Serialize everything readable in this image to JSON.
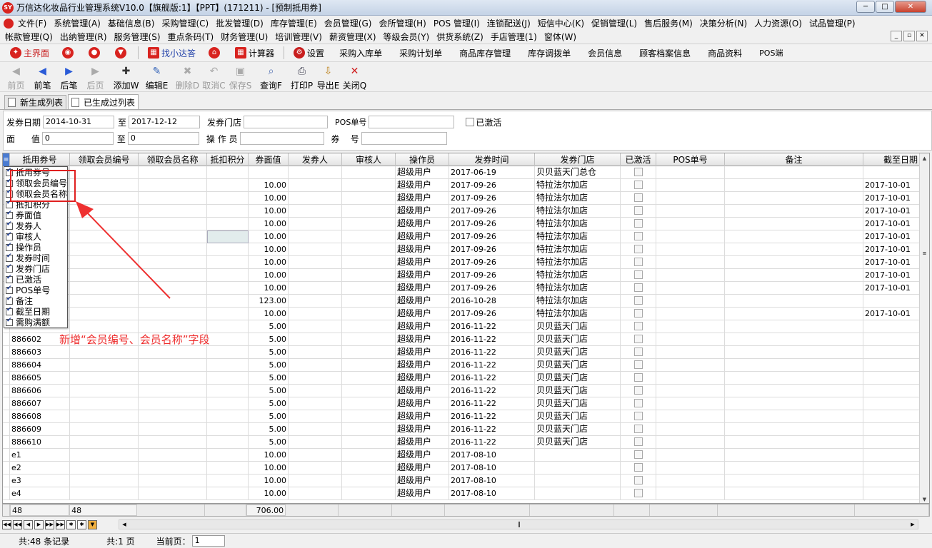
{
  "window": {
    "title": "万信达化妆品行业管理系统V10.0【旗舰版:1】【PPT】(171211) - [预制抵用券]",
    "logo": "SY",
    "min": "─",
    "max": "□",
    "close": "✕"
  },
  "menu": {
    "row1": [
      "文件(F)",
      "系统管理(A)",
      "基础信息(B)",
      "采购管理(C)",
      "批发管理(D)",
      "库存管理(E)",
      "会员管理(G)",
      "会所管理(H)",
      "POS 管理(I)",
      "连锁配送(J)",
      "短信中心(K)",
      "促销管理(L)",
      "售后服务(M)",
      "决策分析(N)",
      "人力资源(O)",
      "试品管理(P)"
    ],
    "row2": [
      "帐款管理(Q)",
      "出纳管理(R)",
      "服务管理(S)",
      "重点条码(T)",
      "财务管理(U)",
      "培训管理(V)",
      "薪资管理(X)",
      "等级会员(Y)",
      "供货系统(Z)",
      "手店管理(1)",
      "窗体(W)"
    ],
    "mdi": [
      "_",
      "▫",
      "✕"
    ]
  },
  "quickbar": {
    "main": "主界面",
    "find": "找小达答",
    "calc": "计算器",
    "settings": "设置",
    "links": [
      "采购入库单",
      "采购计划单",
      "商品库存管理",
      "库存调拨单",
      "会员信息",
      "顾客档案信息",
      "商品资料",
      "POS端"
    ]
  },
  "toolbar": [
    {
      "label": "前页",
      "icon": "◀",
      "disabled": true
    },
    {
      "label": "前笔",
      "icon": "◀",
      "disabled": false
    },
    {
      "label": "后笔",
      "icon": "▶",
      "disabled": false
    },
    {
      "label": "后页",
      "icon": "▶",
      "disabled": true
    },
    {
      "label": "添加W",
      "icon": "✚",
      "disabled": false
    },
    {
      "label": "编辑E",
      "icon": "✎",
      "disabled": false
    },
    {
      "label": "删除D",
      "icon": "✖",
      "disabled": true
    },
    {
      "label": "取消C",
      "icon": "↶",
      "disabled": true
    },
    {
      "label": "保存S",
      "icon": "▣",
      "disabled": true
    },
    {
      "label": "查询F",
      "icon": "⌕",
      "disabled": false
    },
    {
      "label": "打印P",
      "icon": "⎙",
      "disabled": false
    },
    {
      "label": "导出E",
      "icon": "⇩",
      "disabled": false
    },
    {
      "label": "关闭Q",
      "icon": "✕",
      "disabled": false
    }
  ],
  "tabs": [
    "新生成列表",
    "已生成过列表"
  ],
  "filter": {
    "date_label": "发券日期",
    "date_from": "2014-10-31",
    "to_label": "至",
    "date_to": "2017-12-12",
    "store_label": "发券门店",
    "store": "",
    "pos_label": "POS单号",
    "pos": "",
    "activated_label": "已激活",
    "value_label": "面      值",
    "value_from": "0",
    "value_to_label": "至",
    "value_to": "0",
    "operator_label": "操 作 员",
    "operator": "",
    "no_label": "券    号",
    "no": ""
  },
  "grid": {
    "columns": [
      "抵用券号",
      "领取会员编号",
      "领取会员名称",
      "抵扣积分",
      "券面值",
      "发券人",
      "审核人",
      "操作员",
      "发券时间",
      "发券门店",
      "已激活",
      "POS单号",
      "备注",
      "截至日期"
    ],
    "rows": [
      [
        "",
        "",
        "",
        "",
        "",
        "",
        "",
        "超级用户",
        "2017-06-19",
        "贝贝蓝天门总仓",
        "",
        "",
        "",
        ""
      ],
      [
        "",
        "",
        "",
        "",
        "10.00",
        "",
        "",
        "超级用户",
        "2017-09-26",
        "特拉法尔加店",
        "",
        "",
        "",
        "2017-10-01"
      ],
      [
        "",
        "",
        "",
        "",
        "10.00",
        "",
        "",
        "超级用户",
        "2017-09-26",
        "特拉法尔加店",
        "",
        "",
        "",
        "2017-10-01"
      ],
      [
        "",
        "",
        "",
        "",
        "10.00",
        "",
        "",
        "超级用户",
        "2017-09-26",
        "特拉法尔加店",
        "",
        "",
        "",
        "2017-10-01"
      ],
      [
        "",
        "",
        "",
        "",
        "10.00",
        "",
        "",
        "超级用户",
        "2017-09-26",
        "特拉法尔加店",
        "",
        "",
        "",
        "2017-10-01"
      ],
      [
        "",
        "",
        "",
        "",
        "10.00",
        "",
        "",
        "超级用户",
        "2017-09-26",
        "特拉法尔加店",
        "",
        "",
        "",
        "2017-10-01"
      ],
      [
        "",
        "",
        "",
        "",
        "10.00",
        "",
        "",
        "超级用户",
        "2017-09-26",
        "特拉法尔加店",
        "",
        "",
        "",
        "2017-10-01"
      ],
      [
        "",
        "",
        "",
        "",
        "10.00",
        "",
        "",
        "超级用户",
        "2017-09-26",
        "特拉法尔加店",
        "",
        "",
        "",
        "2017-10-01"
      ],
      [
        "",
        "",
        "",
        "",
        "10.00",
        "",
        "",
        "超级用户",
        "2017-09-26",
        "特拉法尔加店",
        "",
        "",
        "",
        "2017-10-01"
      ],
      [
        "",
        "",
        "",
        "",
        "10.00",
        "",
        "",
        "超级用户",
        "2017-09-26",
        "特拉法尔加店",
        "",
        "",
        "",
        "2017-10-01"
      ],
      [
        "",
        "",
        "",
        "",
        "123.00",
        "",
        "",
        "超级用户",
        "2016-10-28",
        "特拉法尔加店",
        "",
        "",
        "",
        ""
      ],
      [
        "",
        "",
        "",
        "",
        "10.00",
        "",
        "",
        "超级用户",
        "2017-09-26",
        "特拉法尔加店",
        "",
        "",
        "",
        "2017-10-01"
      ],
      [
        "",
        "",
        "",
        "",
        "5.00",
        "",
        "",
        "超级用户",
        "2016-11-22",
        "贝贝蓝天门店",
        "",
        "",
        "",
        ""
      ],
      [
        "886602",
        "",
        "",
        "",
        "5.00",
        "",
        "",
        "超级用户",
        "2016-11-22",
        "贝贝蓝天门店",
        "",
        "",
        "",
        ""
      ],
      [
        "886603",
        "",
        "",
        "",
        "5.00",
        "",
        "",
        "超级用户",
        "2016-11-22",
        "贝贝蓝天门店",
        "",
        "",
        "",
        ""
      ],
      [
        "886604",
        "",
        "",
        "",
        "5.00",
        "",
        "",
        "超级用户",
        "2016-11-22",
        "贝贝蓝天门店",
        "",
        "",
        "",
        ""
      ],
      [
        "886605",
        "",
        "",
        "",
        "5.00",
        "",
        "",
        "超级用户",
        "2016-11-22",
        "贝贝蓝天门店",
        "",
        "",
        "",
        ""
      ],
      [
        "886606",
        "",
        "",
        "",
        "5.00",
        "",
        "",
        "超级用户",
        "2016-11-22",
        "贝贝蓝天门店",
        "",
        "",
        "",
        ""
      ],
      [
        "886607",
        "",
        "",
        "",
        "5.00",
        "",
        "",
        "超级用户",
        "2016-11-22",
        "贝贝蓝天门店",
        "",
        "",
        "",
        ""
      ],
      [
        "886608",
        "",
        "",
        "",
        "5.00",
        "",
        "",
        "超级用户",
        "2016-11-22",
        "贝贝蓝天门店",
        "",
        "",
        "",
        ""
      ],
      [
        "886609",
        "",
        "",
        "",
        "5.00",
        "",
        "",
        "超级用户",
        "2016-11-22",
        "贝贝蓝天门店",
        "",
        "",
        "",
        ""
      ],
      [
        "886610",
        "",
        "",
        "",
        "5.00",
        "",
        "",
        "超级用户",
        "2016-11-22",
        "贝贝蓝天门店",
        "",
        "",
        "",
        ""
      ],
      [
        "e1",
        "",
        "",
        "",
        "10.00",
        "",
        "",
        "超级用户",
        "2017-08-10",
        "",
        "",
        "",
        "",
        ""
      ],
      [
        "e2",
        "",
        "",
        "",
        "10.00",
        "",
        "",
        "超级用户",
        "2017-08-10",
        "",
        "",
        "",
        "",
        ""
      ],
      [
        "e3",
        "",
        "",
        "",
        "10.00",
        "",
        "",
        "超级用户",
        "2017-08-10",
        "",
        "",
        "",
        "",
        ""
      ],
      [
        "e4",
        "",
        "",
        "",
        "10.00",
        "",
        "",
        "超级用户",
        "2017-08-10",
        "",
        "",
        "",
        "",
        ""
      ]
    ],
    "footer": {
      "count1": "48",
      "count2": "48",
      "total": "706.00"
    }
  },
  "column_chooser": [
    "抵用券号",
    "领取会员编号",
    "领取会员名称",
    "抵扣积分",
    "券面值",
    "发券人",
    "审核人",
    "操作员",
    "发券时间",
    "发券门店",
    "已激活",
    "POS单号",
    "备注",
    "截至日期",
    "需购满额"
  ],
  "annotation": {
    "text": "新增“会员编号、会员名称”字段",
    "color": "#ee2d2d"
  },
  "status": {
    "records": "共:48 条记录",
    "pages": "共:1 页",
    "current_label": "当前页：",
    "current": "1"
  }
}
